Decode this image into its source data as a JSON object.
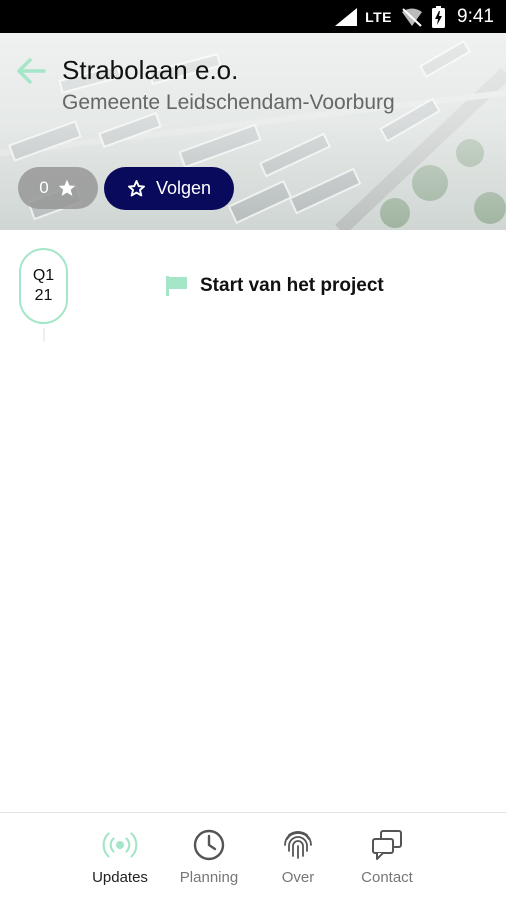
{
  "status_bar": {
    "network": "LTE",
    "time": "9:41"
  },
  "header": {
    "title": "Strabolaan e.o.",
    "subtitle": "Gemeente Leidschendam-Voorburg",
    "rating_count": "0",
    "follow_label": "Volgen"
  },
  "timeline": {
    "entries": [
      {
        "quarter": "Q1",
        "year": "21",
        "title": "Start van het project"
      }
    ]
  },
  "bottom_nav": {
    "active": "Updates",
    "items": [
      {
        "label": "Updates",
        "icon": "broadcast-icon"
      },
      {
        "label": "Planning",
        "icon": "clock-icon"
      },
      {
        "label": "Over",
        "icon": "fingerprint-icon"
      },
      {
        "label": "Contact",
        "icon": "chat-icon"
      }
    ]
  },
  "colors": {
    "accent_mint": "#a5e6c8",
    "follow_button": "#0a0a5c",
    "inactive_nav": "#777777"
  }
}
